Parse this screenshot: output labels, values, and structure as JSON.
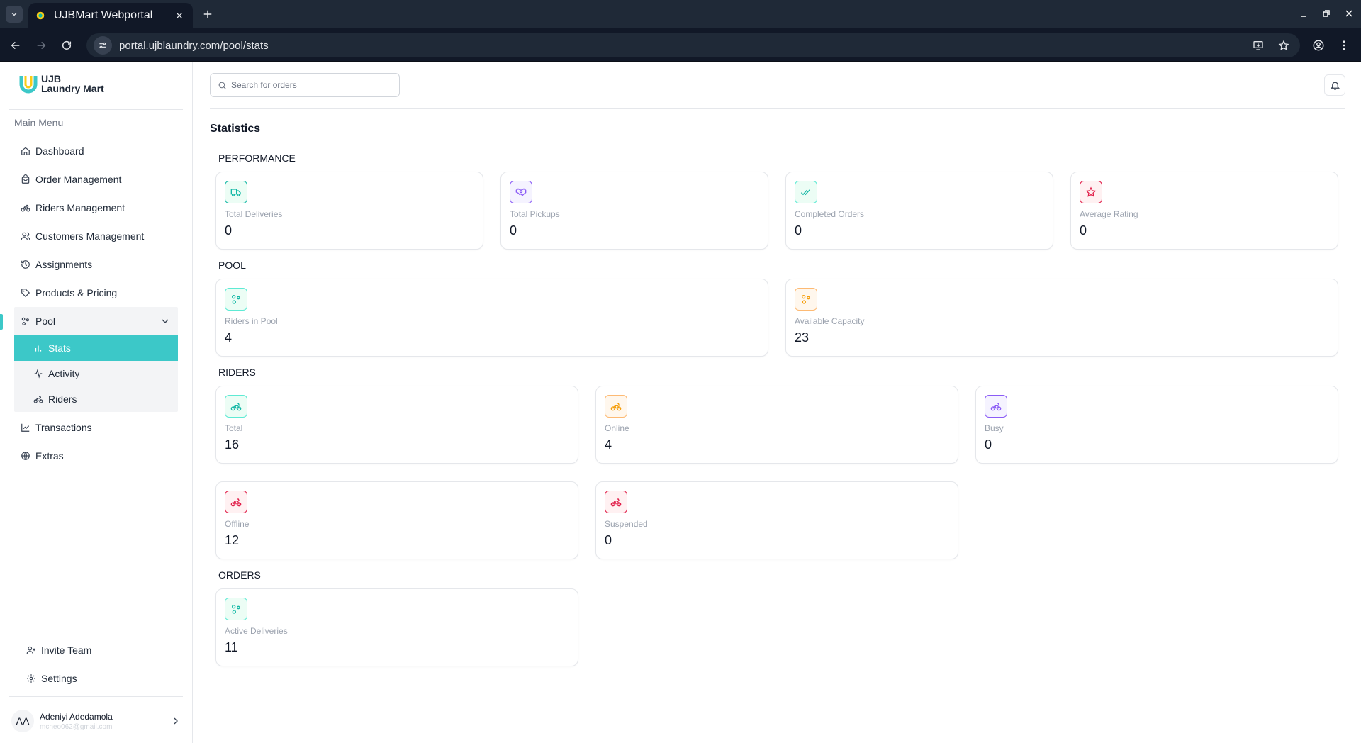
{
  "browser": {
    "tab_title": "UJBMart Webportal",
    "url": "portal.ujblaundry.com/pool/stats"
  },
  "brand": {
    "line1": "UJB",
    "line2": "Laundry Mart",
    "accent_color": "#3cc8c8"
  },
  "sidebar": {
    "section_label": "Main Menu",
    "items": [
      {
        "label": "Dashboard",
        "icon": "home-icon"
      },
      {
        "label": "Order Management",
        "icon": "bag-icon"
      },
      {
        "label": "Riders Management",
        "icon": "bike-icon"
      },
      {
        "label": "Customers Management",
        "icon": "users-icon"
      },
      {
        "label": "Assignments",
        "icon": "history-icon"
      },
      {
        "label": "Products & Pricing",
        "icon": "tag-icon"
      }
    ],
    "pool": {
      "label": "Pool",
      "subitems": [
        {
          "label": "Stats",
          "icon": "bar-chart-icon"
        },
        {
          "label": "Activity",
          "icon": "activity-icon"
        },
        {
          "label": "Riders",
          "icon": "bike-icon"
        }
      ]
    },
    "items_after": [
      {
        "label": "Transactions",
        "icon": "line-chart-icon"
      },
      {
        "label": "Extras",
        "icon": "globe-icon"
      }
    ],
    "bottom": [
      {
        "label": "Invite Team",
        "icon": "user-plus-icon"
      },
      {
        "label": "Settings",
        "icon": "gear-icon"
      }
    ],
    "user": {
      "initials": "AA",
      "name": "Adeniyi Adedamola",
      "email": "mcneo062@gmail.com"
    }
  },
  "header": {
    "search_placeholder": "Search for orders"
  },
  "page": {
    "title": "Statistics",
    "sections": {
      "performance": {
        "label": "PERFORMANCE",
        "cards": [
          {
            "label": "Total Deliveries",
            "value": "0",
            "icon": "truck-icon",
            "color": "#14b8a6"
          },
          {
            "label": "Total Pickups",
            "value": "0",
            "icon": "handshake-icon",
            "color": "#8b5cf6"
          },
          {
            "label": "Completed Orders",
            "value": "0",
            "icon": "check-check-icon",
            "color": "#14b8a6"
          },
          {
            "label": "Average Rating",
            "value": "0",
            "icon": "star-icon",
            "color": "#e11d48"
          }
        ]
      },
      "pool": {
        "label": "POOL",
        "cards": [
          {
            "label": "Riders in Pool",
            "value": "4",
            "icon": "pool-icon",
            "color": "#14b8a6"
          },
          {
            "label": "Available Capacity",
            "value": "23",
            "icon": "pool-icon",
            "color": "#f59e0b"
          }
        ]
      },
      "riders": {
        "label": "RIDERS",
        "cards": [
          {
            "label": "Total",
            "value": "16",
            "icon": "bike-icon",
            "color": "#14b8a6"
          },
          {
            "label": "Online",
            "value": "4",
            "icon": "bike-icon",
            "color": "#f59e0b"
          },
          {
            "label": "Busy",
            "value": "0",
            "icon": "bike-icon",
            "color": "#8b5cf6"
          },
          {
            "label": "Offline",
            "value": "12",
            "icon": "bike-icon",
            "color": "#e11d48"
          },
          {
            "label": "Suspended",
            "value": "0",
            "icon": "bike-icon",
            "color": "#e11d48"
          }
        ]
      },
      "orders": {
        "label": "ORDERS",
        "cards": [
          {
            "label": "Active Deliveries",
            "value": "11",
            "icon": "pool-icon",
            "color": "#14b8a6"
          }
        ]
      }
    }
  }
}
